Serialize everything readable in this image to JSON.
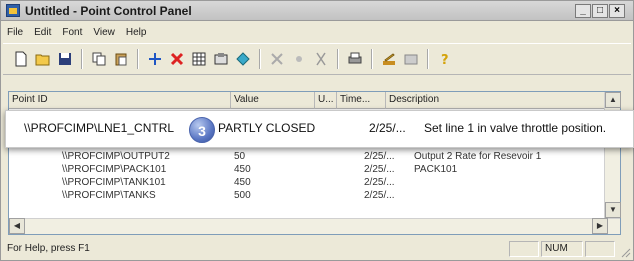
{
  "window": {
    "title": "Untitled - Point Control Panel",
    "buttons": {
      "minimize": "_",
      "maximize": "□",
      "close": "×"
    }
  },
  "menu": [
    "File",
    "Edit",
    "Font",
    "View",
    "Help"
  ],
  "toolbar": {
    "icons": [
      "new-file-icon",
      "open-folder-icon",
      "save-icon",
      "copy-icon",
      "paste-icon",
      "add-point-icon",
      "delete-point-icon",
      "grid-icon",
      "properties-icon",
      "diamond-icon",
      "tool-icon",
      "record-icon",
      "cut-icon",
      "print-icon",
      "edit-icon",
      "view-icon",
      "help-icon"
    ]
  },
  "list": {
    "columns": [
      "Point ID",
      "Value",
      "U...",
      "Time...",
      "Description"
    ],
    "rows": [
      {
        "id": "\\\\PROFCIMP\\OUTPUT2",
        "value": "50",
        "time": "2/25/...",
        "desc": "Output 2 Rate for Resevoir 1"
      },
      {
        "id": "\\\\PROFCIMP\\PACK101",
        "value": "450",
        "time": "2/25/...",
        "desc": "PACK101"
      },
      {
        "id": "\\\\PROFCIMP\\TANK101",
        "value": "450",
        "time": "2/25/...",
        "desc": ""
      },
      {
        "id": "\\\\PROFCIMP\\TANKS",
        "value": "500",
        "time": "2/25/...",
        "desc": ""
      }
    ],
    "highlight": {
      "id": "\\\\PROFCIMP\\LNE1_CNTRL",
      "badge": "3",
      "value": "PARTLY CLOSED",
      "time": "2/25/...",
      "desc": "Set line 1 in valve  throttle position."
    }
  },
  "status": {
    "help": "For Help, press F1",
    "num": "NUM"
  }
}
